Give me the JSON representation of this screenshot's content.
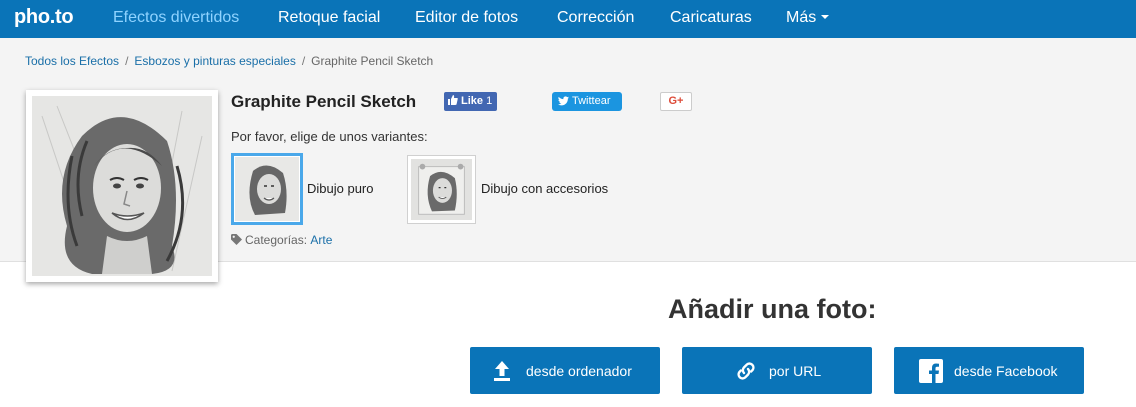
{
  "nav": {
    "logo": "pho.to",
    "items": [
      {
        "label": "Efectos divertidos",
        "active": true
      },
      {
        "label": "Retoque facial"
      },
      {
        "label": "Editor de fotos"
      },
      {
        "label": "Corrección"
      },
      {
        "label": "Caricaturas"
      },
      {
        "label": "Más"
      }
    ]
  },
  "breadcrumb": {
    "items": [
      "Todos los Efectos",
      "Esbozos y pinturas especiales",
      "Graphite Pencil Sketch"
    ],
    "separator": "/"
  },
  "effect": {
    "title": "Graphite Pencil Sketch",
    "share": {
      "like_label": "Like",
      "like_count": "1",
      "twitter_label": "Twittear",
      "gplus_label": "G+"
    },
    "variants_prompt": "Por favor, elige de unos variantes:",
    "variants": [
      {
        "label": "Dibujo puro",
        "selected": true
      },
      {
        "label": "Dibujo con accesorios",
        "selected": false
      }
    ],
    "categories_label": "Categorías:",
    "category": "Arte"
  },
  "upload": {
    "title": "Añadir una foto:",
    "buttons": [
      {
        "label": "desde ordenador",
        "icon": "upload-icon"
      },
      {
        "label": "por URL",
        "icon": "link-icon"
      },
      {
        "label": "desde Facebook",
        "icon": "facebook-icon"
      }
    ]
  },
  "colors": {
    "nav_bg": "#0a74b8",
    "nav_active": "#8fd3ff",
    "link": "#1a6fa8",
    "button_bg": "#0a74b8",
    "facebook": "#4267b2",
    "twitter": "#1b95e0"
  }
}
